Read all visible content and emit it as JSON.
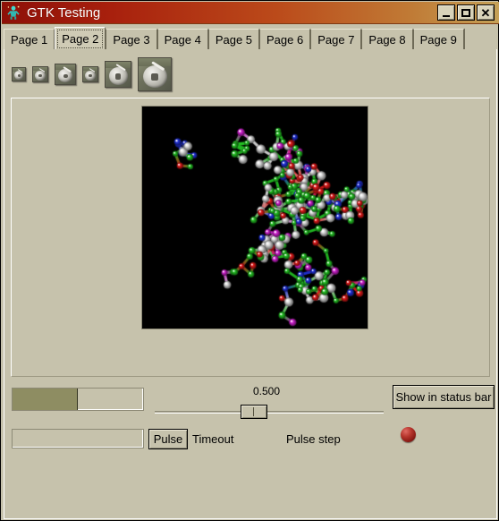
{
  "window": {
    "title": "GTK Testing",
    "app_icon": "gtk-logo-icon",
    "buttons": {
      "minimize": "minimize-icon",
      "maximize": "maximize-icon",
      "close": "close-icon"
    }
  },
  "notebook": {
    "tabs": [
      {
        "label": "Page 1",
        "active": false
      },
      {
        "label": "Page 2",
        "active": true
      },
      {
        "label": "Page 3",
        "active": false
      },
      {
        "label": "Page 4",
        "active": false
      },
      {
        "label": "Page 5",
        "active": false
      },
      {
        "label": "Page 6",
        "active": false
      },
      {
        "label": "Page 7",
        "active": false
      },
      {
        "label": "Page 8",
        "active": false
      },
      {
        "label": "Page 9",
        "active": false
      }
    ]
  },
  "toolbar": {
    "icons": [
      {
        "name": "disc-icon-xs",
        "size": 16
      },
      {
        "name": "disc-icon-s",
        "size": 18
      },
      {
        "name": "disc-icon-m",
        "size": 24
      },
      {
        "name": "disc-icon-s2",
        "size": 18
      },
      {
        "name": "disc-icon-l",
        "size": 30
      },
      {
        "name": "disc-icon-xl",
        "size": 38
      }
    ]
  },
  "image_area": {
    "name": "molecule-render",
    "description": "Molecular structure ball-and-stick rendering on black background",
    "background": "#000000",
    "atom_colors": {
      "carbon": "#22c022",
      "oxygen": "#e01818",
      "nitrogen": "#2030d8",
      "phosphorus": "#d020d0",
      "hydrogen": "#d8d8d8"
    }
  },
  "controls": {
    "progress_primary": {
      "name": "progress-bar-primary",
      "fraction": 0.5,
      "fill_color": "#8e8d62",
      "text": ""
    },
    "progress_pulse": {
      "name": "progress-bar-pulse",
      "fraction": 0,
      "text": ""
    },
    "pulse_button": "Pulse",
    "timeout_label": "Timeout",
    "pulse_step_label": "Pulse step",
    "scale": {
      "value_text": "0.500",
      "value": 0.5,
      "min": 0,
      "max": 1
    },
    "status_button": "Show in status bar",
    "led": {
      "name": "status-led",
      "color": "#b5352c",
      "state": "on"
    }
  }
}
